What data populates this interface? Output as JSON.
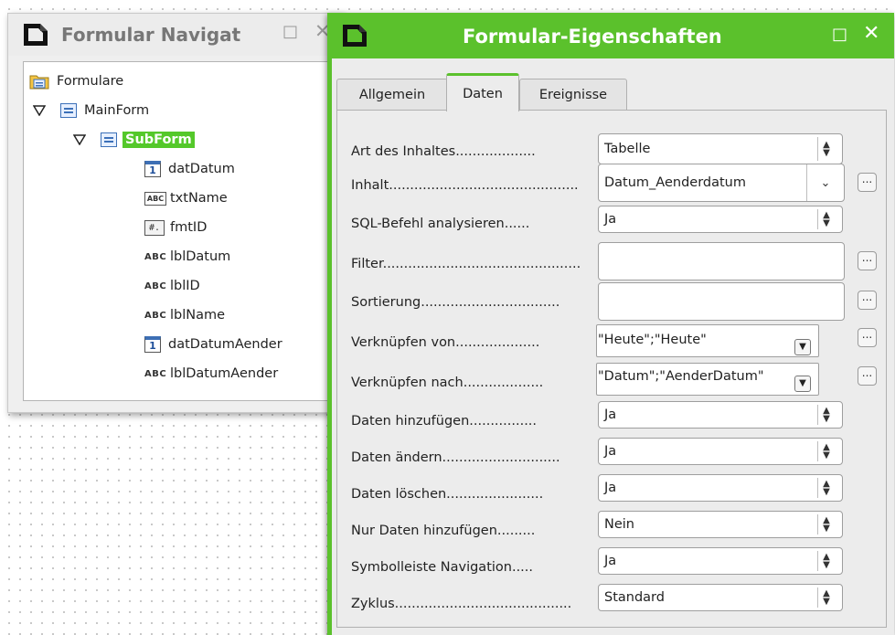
{
  "navigator": {
    "title": "Formular Navigat",
    "min_glyph": "□",
    "close_glyph": "✕",
    "tree": {
      "root": "Formulare",
      "main_form": "MainForm",
      "sub_form": "SubForm",
      "controls": [
        {
          "label": "datDatum",
          "icon": "date-field-icon",
          "glyph": "1"
        },
        {
          "label": "txtName",
          "icon": "text-box-icon",
          "glyph": "ABC"
        },
        {
          "label": "fmtID",
          "icon": "formatted-field-icon",
          "glyph": "#."
        },
        {
          "label": "lblDatum",
          "icon": "label-icon",
          "glyph": "ABC"
        },
        {
          "label": "lblID",
          "icon": "label-icon",
          "glyph": "ABC"
        },
        {
          "label": "lblName",
          "icon": "label-icon",
          "glyph": "ABC"
        },
        {
          "label": "datDatumAender",
          "icon": "date-field-icon",
          "glyph": "1"
        },
        {
          "label": "lblDatumAender",
          "icon": "label-icon",
          "glyph": "ABC"
        }
      ]
    }
  },
  "properties": {
    "title": "Formular-Eigenschaften",
    "min_glyph": "□",
    "close_glyph": "✕",
    "tabs": [
      "Allgemein",
      "Daten",
      "Ereignisse"
    ],
    "active_tab": "Daten",
    "accent_color": "#5bc12c",
    "rows": [
      {
        "label": "Art des Inhaltes...................",
        "value": "Tabelle"
      },
      {
        "label": "Inhalt.............................................",
        "value": "Datum_Aenderdatum"
      },
      {
        "label": "SQL-Befehl analysieren......",
        "value": "Ja"
      },
      {
        "label": "Filter...............................................",
        "value": ""
      },
      {
        "label": "Sortierung.................................",
        "value": ""
      },
      {
        "label": "Verknüpfen von....................",
        "value": "\"Heute\";\"Heute\""
      },
      {
        "label": "Verknüpfen nach...................",
        "value": "\"Datum\";\"AenderDatum\""
      },
      {
        "label": "Daten hinzufügen................",
        "value": "Ja"
      },
      {
        "label": "Daten ändern............................",
        "value": "Ja"
      },
      {
        "label": "Daten löschen.......................",
        "value": "Ja"
      },
      {
        "label": "Nur Daten hinzufügen.........",
        "value": "Nein"
      },
      {
        "label": "Symbolleiste Navigation.....",
        "value": "Ja"
      },
      {
        "label": "Zyklus..........................................",
        "value": "Standard"
      }
    ],
    "ellipsis_glyph": "...",
    "spin_up": "▲",
    "spin_down": "▼",
    "chevron": "⌄",
    "dropdown_glyph": "▼"
  }
}
